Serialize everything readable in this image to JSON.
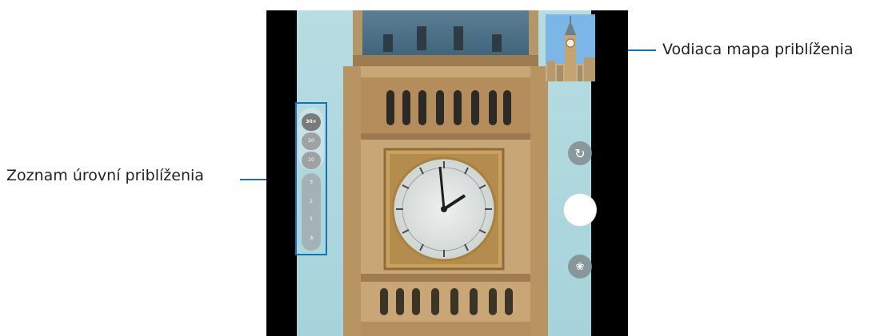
{
  "callouts": {
    "zoom_map": "Vodiaca mapa priblíženia",
    "zoom_levels": "Zoznam úrovní priblíženia"
  },
  "zoom_panel": {
    "levels": [
      "30×",
      "20",
      "10",
      "3",
      "2",
      "1",
      ".6"
    ],
    "selected_index": 0
  },
  "icons": {
    "switch_camera": "refresh-icon",
    "shutter": "shutter-button",
    "effects": "flower-icon"
  },
  "colors": {
    "callout_line": "#1673b3",
    "sky": "#a9d6dc",
    "stone": "#c9a676"
  }
}
